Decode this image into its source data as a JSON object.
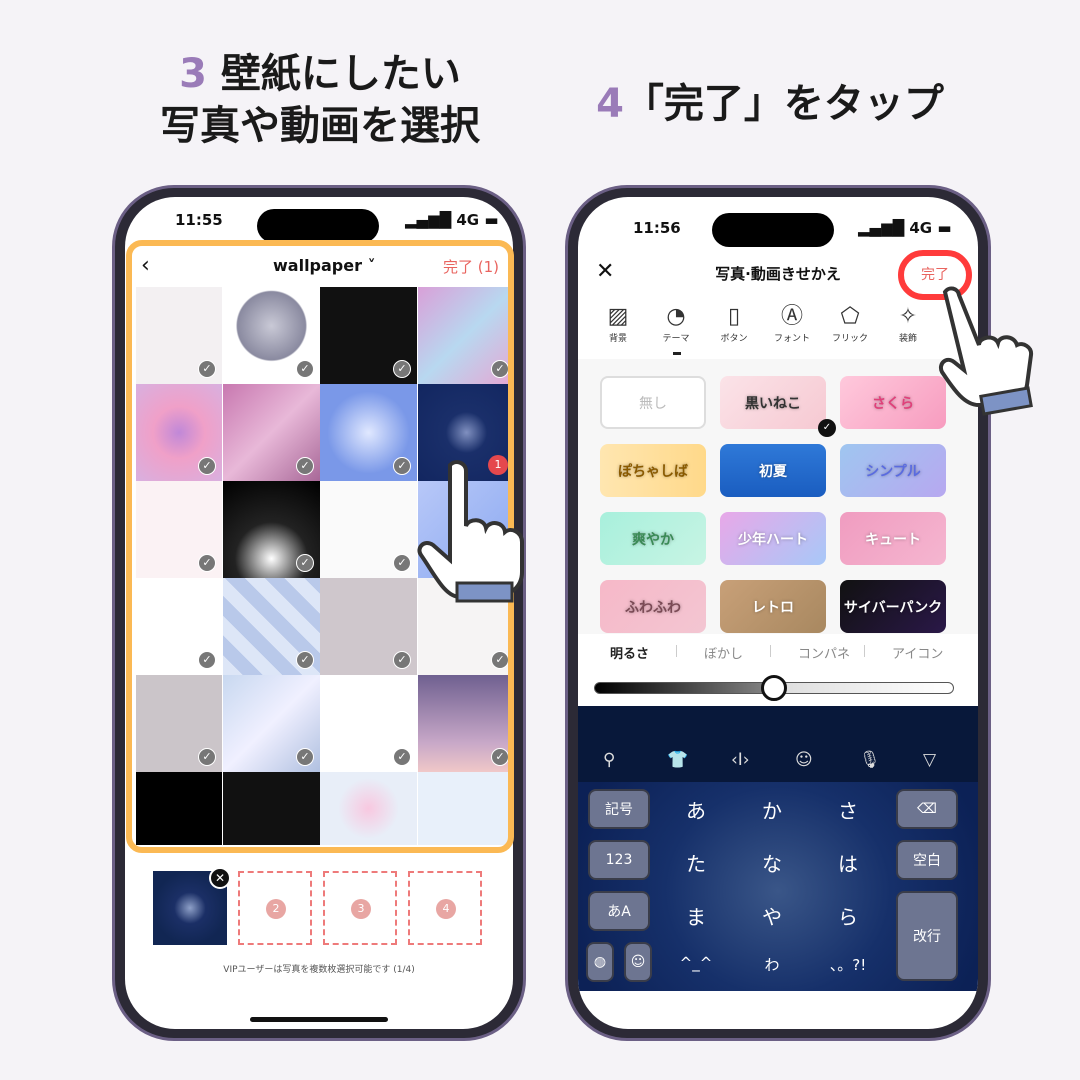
{
  "left_heading": {
    "step": "3",
    "line1": "壁紙にしたい",
    "line2": "写真や動画を選択"
  },
  "right_heading": {
    "step": "4",
    "text": "「完了」をタップ"
  },
  "left_phone": {
    "time": "11:55",
    "network": "4G",
    "header": {
      "back_icon": "chevron-left",
      "album": "wallpaper",
      "done": "完了 (1)"
    },
    "selected_badge": "1",
    "slots": [
      "2",
      "3",
      "4"
    ],
    "footer_note": "VIPユーザーは写真を複数枚選択可能です (1/4)",
    "highlight_color": "#fbb954"
  },
  "right_phone": {
    "time": "11:56",
    "network": "4G",
    "header": {
      "title": "写真·動画きせかえ",
      "done": "完了",
      "close_icon": "x"
    },
    "tools": [
      {
        "label": "背景",
        "icon": "▨"
      },
      {
        "label": "テーマ",
        "icon": "◔"
      },
      {
        "label": "ボタン",
        "icon": "▯"
      },
      {
        "label": "フォント",
        "icon": "Ⓐ"
      },
      {
        "label": "フリック",
        "icon": "⬠"
      },
      {
        "label": "装飾",
        "icon": "✧"
      }
    ],
    "themes": [
      "無し",
      "黒いねこ",
      "さくら",
      "ぽちゃしば",
      "初夏",
      "シンプル",
      "爽やか",
      "少年ハート",
      "キュート",
      "ふわふわ",
      "レトロ",
      "サイバーパンク"
    ],
    "selected_theme": "黒いねこ",
    "adjust_tabs": [
      "明るさ",
      "ぼかし",
      "コンパネ",
      "アイコン"
    ],
    "brightness_percent": 50,
    "keyboard": {
      "toolbar_icons": [
        "search",
        "shirt",
        "cursor",
        "bear-face",
        "microphone",
        "collapse"
      ],
      "left_keys": [
        "記号",
        "123",
        "あA"
      ],
      "kana": [
        "あ",
        "か",
        "さ",
        "た",
        "な",
        "は",
        "ま",
        "や",
        "ら",
        "^_^",
        "わ",
        "、。?!"
      ],
      "right_keys": [
        "⌫",
        "空白",
        "改行"
      ]
    },
    "highlight_color": "#ff3b3b"
  }
}
